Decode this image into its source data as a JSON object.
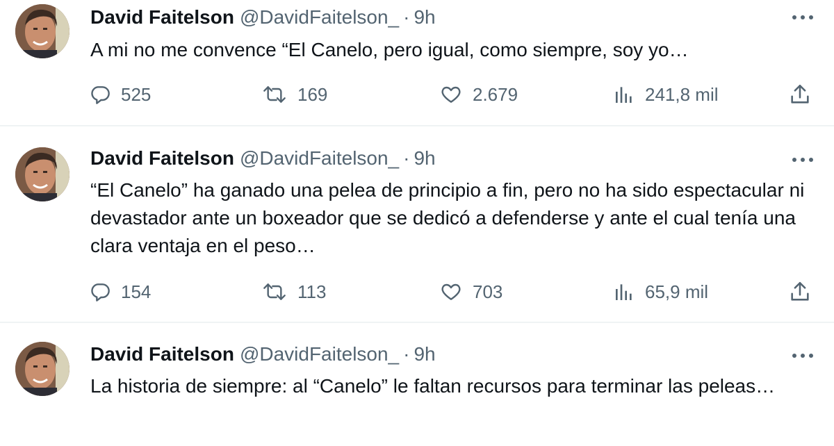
{
  "tweets": [
    {
      "author_name": "David Faitelson",
      "handle": "@DavidFaitelson_",
      "separator": "·",
      "time": "9h",
      "text": "A mi no me convence “El Canelo, pero igual, como siempre, soy yo…",
      "replies": "525",
      "retweets": "169",
      "likes": "2.679",
      "views": "241,8 mil"
    },
    {
      "author_name": "David Faitelson",
      "handle": "@DavidFaitelson_",
      "separator": "·",
      "time": "9h",
      "text": "“El Canelo” ha ganado una pelea de principio a fin, pero no ha sido espectacular ni devastador ante un boxeador que se dedicó a defenderse y ante el cual tenía una clara ventaja en el peso…",
      "replies": "154",
      "retweets": "113",
      "likes": "703",
      "views": "65,9 mil"
    },
    {
      "author_name": "David Faitelson",
      "handle": "@DavidFaitelson_",
      "separator": "·",
      "time": "9h",
      "text": "La historia de siempre: al “Canelo” le faltan recursos para terminar las peleas…"
    }
  ],
  "icons": {
    "reply": "reply-icon",
    "retweet": "retweet-icon",
    "like": "heart-icon",
    "views": "views-icon",
    "share": "share-icon",
    "more": "more-icon"
  },
  "colors": {
    "text_primary": "#0f1419",
    "text_secondary": "#536471",
    "divider": "#eff3f4"
  }
}
